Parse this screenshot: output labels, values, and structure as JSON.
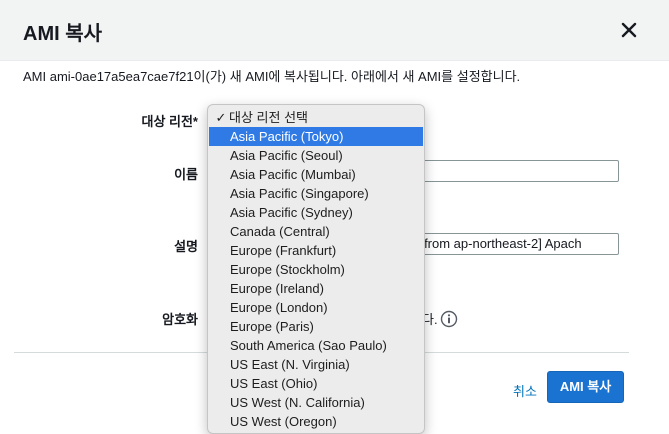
{
  "dialog": {
    "title": "AMI 복사",
    "description": "AMI ami-0ae17a5ea7cae7f21이(가) 새 AMI에 복사됩니다. 아래에서 새 AMI를 설정합니다."
  },
  "form": {
    "region_label": "대상 리전*",
    "name_label": "이름",
    "name_value": "",
    "desc_label": "설명",
    "desc_value": "21 from ap-northeast-2] Apach",
    "encryption_label": "암호화",
    "encryption_text_tail": "다."
  },
  "dropdown": {
    "header": "대상 리전 선택",
    "check": "✓",
    "options": [
      "Asia Pacific (Tokyo)",
      "Asia Pacific (Seoul)",
      "Asia Pacific (Mumbai)",
      "Asia Pacific (Singapore)",
      "Asia Pacific (Sydney)",
      "Canada (Central)",
      "Europe (Frankfurt)",
      "Europe (Stockholm)",
      "Europe (Ireland)",
      "Europe (London)",
      "Europe (Paris)",
      "South America (Sao Paulo)",
      "US East (N. Virginia)",
      "US East (Ohio)",
      "US West (N. California)",
      "US West (Oregon)"
    ],
    "selected_index": 0
  },
  "footer": {
    "cancel_label": "취소",
    "copy_label": "AMI 복사"
  },
  "colors": {
    "primary": "#1a73d1",
    "link": "#0073bb",
    "selected": "#2f7ae5"
  }
}
